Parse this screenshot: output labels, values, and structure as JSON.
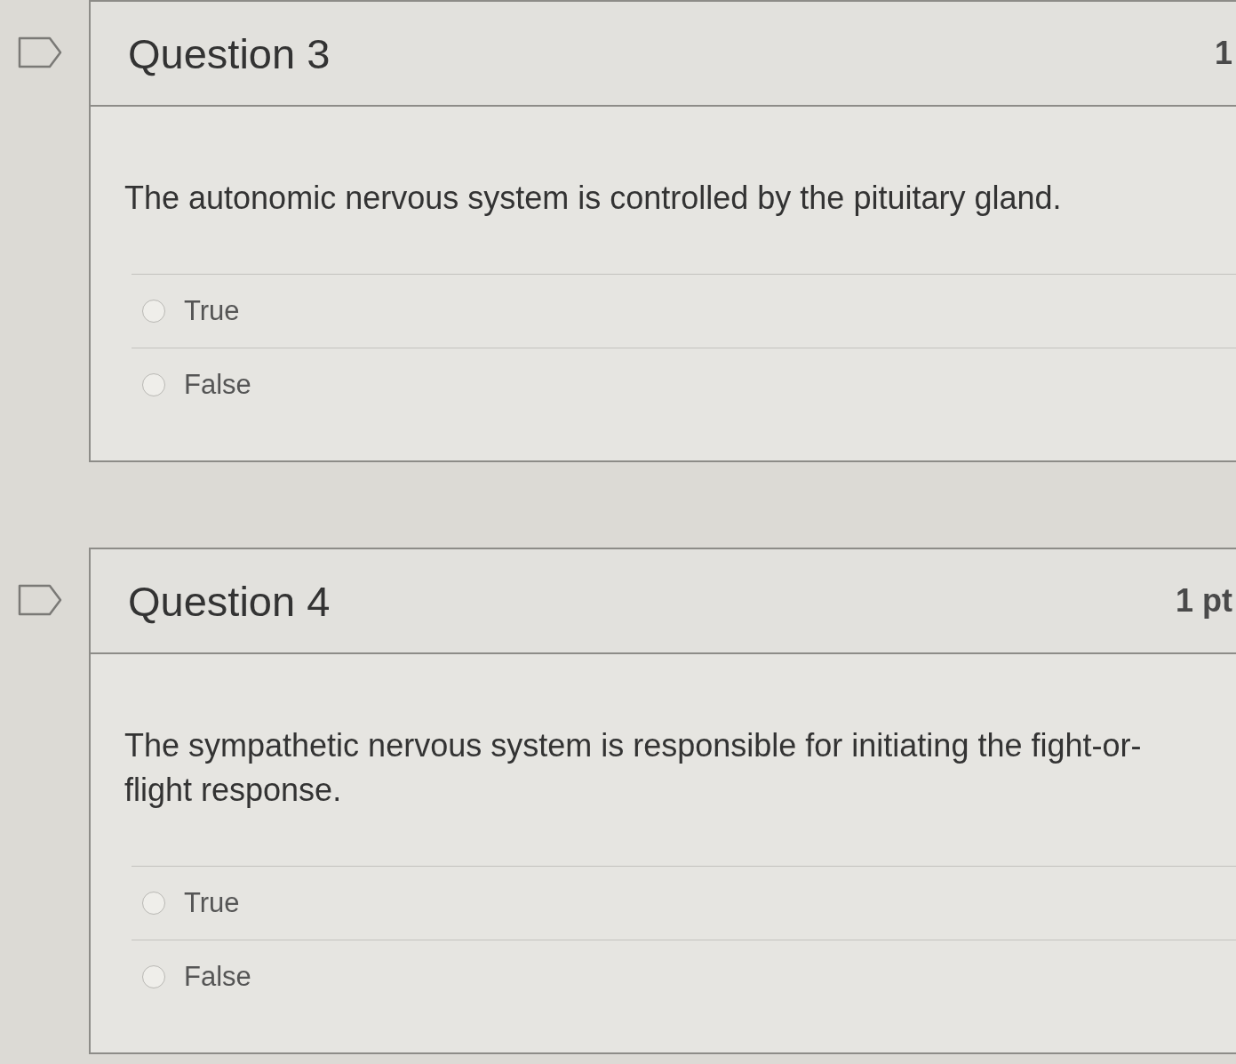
{
  "questions": [
    {
      "title": "Question 3",
      "points": "1",
      "text": "The autonomic nervous system is controlled by the pituitary gland.",
      "answers": [
        {
          "label": "True",
          "selected": false
        },
        {
          "label": "False",
          "selected": false
        }
      ]
    },
    {
      "title": "Question 4",
      "points": "1 pt",
      "text": "The sympathetic nervous system is responsible for initiating the fight-or-flight response.",
      "answers": [
        {
          "label": "True",
          "selected": false
        },
        {
          "label": "False",
          "selected": false
        }
      ]
    }
  ]
}
